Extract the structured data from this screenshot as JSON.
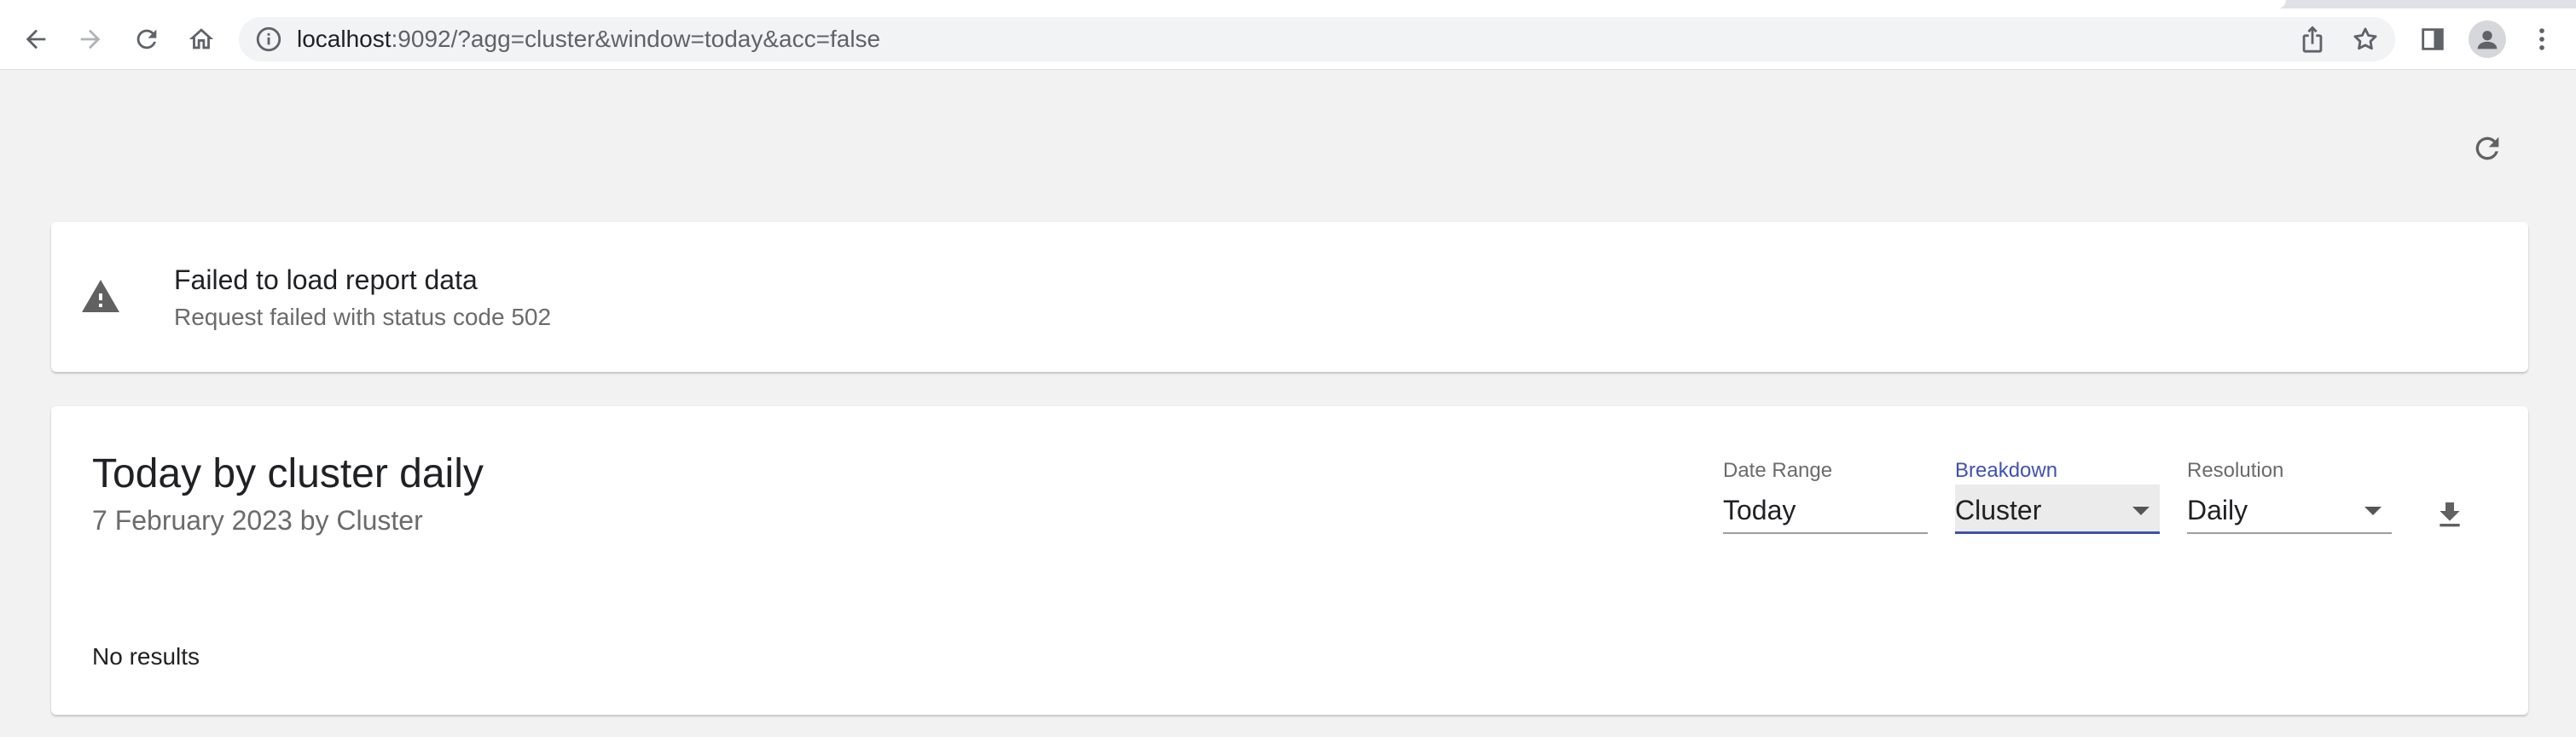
{
  "browser": {
    "url_host": "localhost",
    "url_rest": ":9092/?agg=cluster&window=today&acc=false",
    "icons": {
      "back": "arrow-left-icon",
      "forward": "arrow-right-icon",
      "reload": "reload-icon",
      "home": "home-icon",
      "info": "info-circle-icon",
      "share": "share-icon",
      "bookmark": "star-icon",
      "side_panel": "side-panel-icon",
      "profile": "person-icon",
      "menu": "more-vert-icon"
    }
  },
  "page": {
    "refresh_icon": "refresh-icon",
    "alert": {
      "icon": "warning-icon",
      "title": "Failed to load report data",
      "message": "Request failed with status code 502"
    },
    "report": {
      "title": "Today by cluster daily",
      "subtitle": "7 February 2023 by Cluster",
      "controls": {
        "date_range": {
          "label": "Date Range",
          "value": "Today"
        },
        "breakdown": {
          "label": "Breakdown",
          "value": "Cluster"
        },
        "resolution": {
          "label": "Resolution",
          "value": "Daily"
        }
      },
      "download_icon": "download-icon",
      "empty_message": "No results"
    }
  },
  "colors": {
    "accent": "#3f51b5",
    "background": "#f2f2f2",
    "card": "#ffffff",
    "muted_text": "#6b6b6b"
  }
}
